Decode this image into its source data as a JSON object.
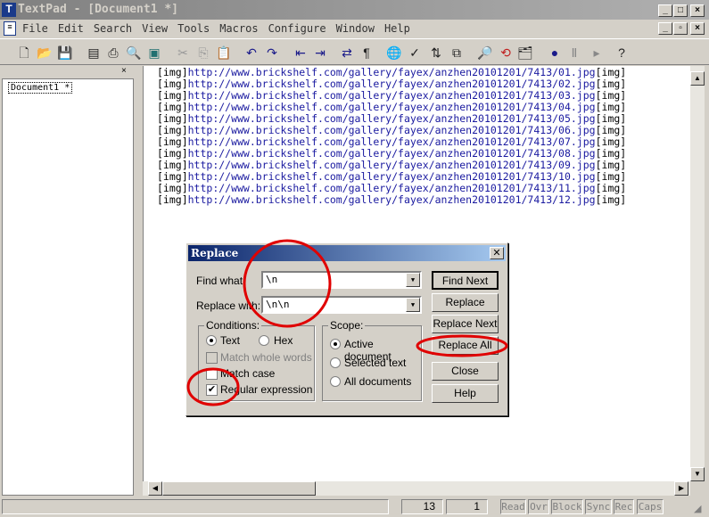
{
  "window": {
    "title": "TextPad - [Document1 *]"
  },
  "menu": [
    "File",
    "Edit",
    "Search",
    "View",
    "Tools",
    "Macros",
    "Configure",
    "Window",
    "Help"
  ],
  "toolbar_icons": [
    "new-icon",
    "open-icon",
    "save-icon",
    "save-all-icon",
    "print-icon",
    "print-preview-icon",
    "view-icon",
    "cut-icon",
    "copy-icon",
    "paste-icon",
    "undo-icon",
    "redo-icon",
    "outdent-icon",
    "indent-icon",
    "word-wrap-icon",
    "pilcrow-icon",
    "web-icon",
    "spell-check-icon",
    "sort-icon",
    "compare-icon",
    "find-icon",
    "replace-icon",
    "find-in-files-icon",
    "record-macro-icon",
    "play-macro-icon",
    "next-icon",
    "help-icon"
  ],
  "sidebar": {
    "documents": [
      "Document1 *"
    ]
  },
  "editor": {
    "lines": [
      {
        "pre": "[img]",
        "url": "http://www.brickshelf.com/gallery/fayex/anzhen20101201/7413/01.jpg",
        "post": "[img]"
      },
      {
        "pre": "[img]",
        "url": "http://www.brickshelf.com/gallery/fayex/anzhen20101201/7413/02.jpg",
        "post": "[img]"
      },
      {
        "pre": "[img]",
        "url": "http://www.brickshelf.com/gallery/fayex/anzhen20101201/7413/03.jpg",
        "post": "[img]"
      },
      {
        "pre": "[img]",
        "url": "http://www.brickshelf.com/gallery/fayex/anzhen20101201/7413/04.jpg",
        "post": "[img]"
      },
      {
        "pre": "[img]",
        "url": "http://www.brickshelf.com/gallery/fayex/anzhen20101201/7413/05.jpg",
        "post": "[img]"
      },
      {
        "pre": "[img]",
        "url": "http://www.brickshelf.com/gallery/fayex/anzhen20101201/7413/06.jpg",
        "post": "[img]"
      },
      {
        "pre": "[img]",
        "url": "http://www.brickshelf.com/gallery/fayex/anzhen20101201/7413/07.jpg",
        "post": "[img]"
      },
      {
        "pre": "[img]",
        "url": "http://www.brickshelf.com/gallery/fayex/anzhen20101201/7413/08.jpg",
        "post": "[img]"
      },
      {
        "pre": "[img]",
        "url": "http://www.brickshelf.com/gallery/fayex/anzhen20101201/7413/09.jpg",
        "post": "[img]"
      },
      {
        "pre": "[img]",
        "url": "http://www.brickshelf.com/gallery/fayex/anzhen20101201/7413/10.jpg",
        "post": "[img]"
      },
      {
        "pre": "[img]",
        "url": "http://www.brickshelf.com/gallery/fayex/anzhen20101201/7413/11.jpg",
        "post": "[img]"
      },
      {
        "pre": "[img]",
        "url": "http://www.brickshelf.com/gallery/fayex/anzhen20101201/7413/12.jpg",
        "post": "[img]"
      }
    ]
  },
  "dialog": {
    "title": "Replace",
    "find_label": "Find what:",
    "find_value": "\\n",
    "replace_label": "Replace with:",
    "replace_value": "\\n\\n",
    "conditions_label": "Conditions:",
    "text_label": "Text",
    "hex_label": "Hex",
    "whole_words_label": "Match whole words",
    "match_case_label": "Match case",
    "regex_label": "Regular expression",
    "scope_label": "Scope:",
    "active_doc_label": "Active document",
    "selected_text_label": "Selected text",
    "all_docs_label": "All documents",
    "buttons": {
      "find_next": "Find Next",
      "replace": "Replace",
      "replace_next": "Replace Next",
      "replace_all": "Replace All",
      "close": "Close",
      "help": "Help"
    },
    "state": {
      "mode": "Text",
      "scope": "Active document",
      "match_whole_words": false,
      "match_case": false,
      "regular_expression": true
    }
  },
  "status": {
    "line": "13",
    "column": "1",
    "indicators": [
      "Read",
      "Ovr",
      "Block",
      "Sync",
      "Rec",
      "Caps"
    ]
  },
  "annotation_color": "#e00000"
}
